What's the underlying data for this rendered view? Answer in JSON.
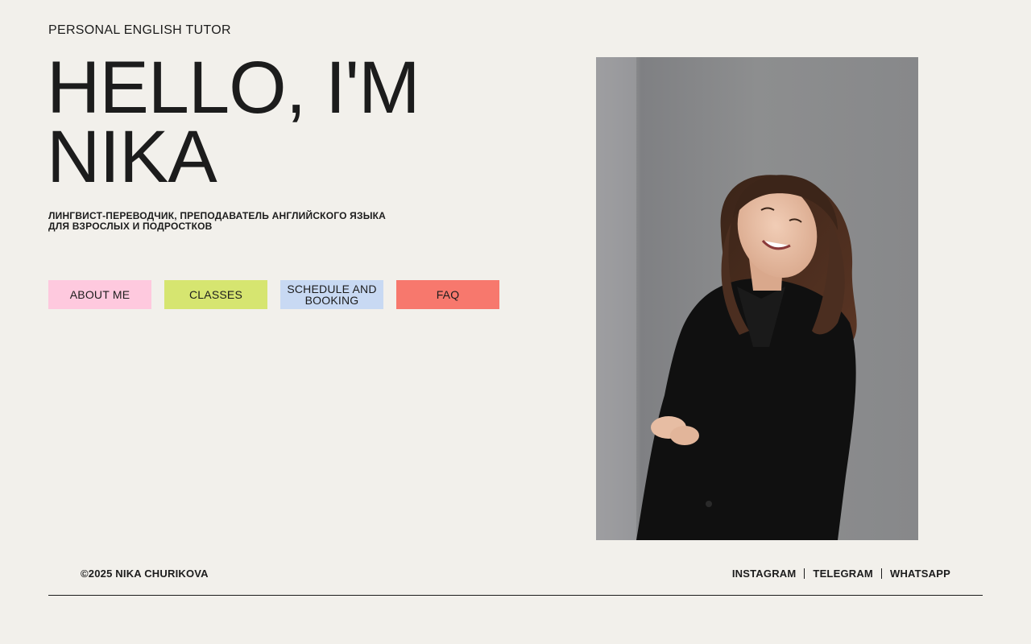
{
  "header": {
    "brand": "PERSONAL ENGLISH TUTOR"
  },
  "hero": {
    "title_line1": "HELLO, I'M",
    "title_line2": "NIKA",
    "subtitle_line1": "ЛИНГВИСТ-ПЕРЕВОДЧИК, ПРЕПОДАВАТЕЛЬ АНГЛИЙСКОГО ЯЗЫКА",
    "subtitle_line2": "ДЛЯ ВЗРОСЛЫХ И ПОДРОСТКОВ"
  },
  "nav": {
    "about": "ABOUT ME",
    "classes": "CLASSES",
    "schedule": "SCHEDULE AND BOOKING",
    "faq": "FAQ"
  },
  "colors": {
    "background": "#f2f0eb",
    "about": "#fec9de",
    "classes": "#d6e570",
    "schedule": "#c8d9f3",
    "faq": "#f7786d"
  },
  "footer": {
    "copyright": "©2025 NIKA CHURIKOVA",
    "social": {
      "instagram": "INSTAGRAM",
      "telegram": "TELEGRAM",
      "whatsapp": "WHATSAPP"
    }
  }
}
